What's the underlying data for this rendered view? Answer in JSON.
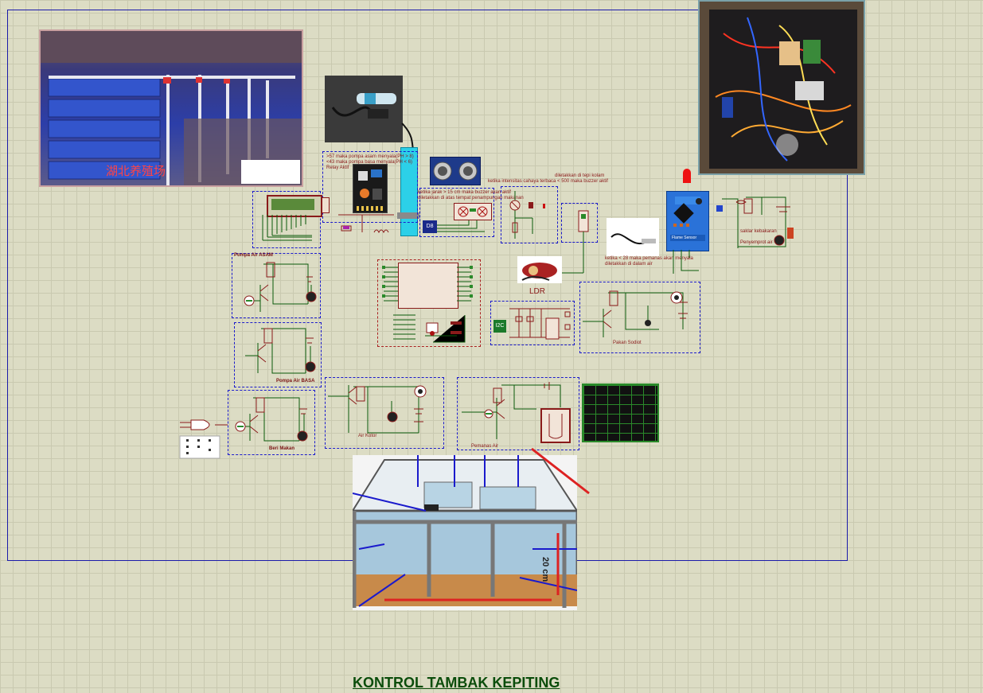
{
  "title": "KONTROL TAMBAK KEPITING",
  "labels": {
    "ph_note_1": ">57 maka pompa asam menyala(PH > 8)",
    "ph_note_2": "<43 maka pompa basa menyala(PH < 6)",
    "ph_note_3": "Relay Aktif",
    "ultrasonic_note_1": "ketika jarak > 15 cm maka buzzer akan aktif",
    "ultrasonic_note_2": "diletakkan di atas tempat penampungan makanan",
    "ldr_note_1": "diletakkan di tepi kolam",
    "ldr_note_2": "ketika intensitas cahaya terbaca < 500 maka buzzer aktif",
    "temp_note_1": "ketika < 28 maka pemanas akan menyala",
    "temp_note_2": "diletakkan di dalam air",
    "fire_note_1": "saklar kebakaran",
    "fire_note_2": "Penyemprot air",
    "pompa_asam": "Pompa Air ASAM",
    "pompa_basa": "Pompa Air BASA",
    "beri_makan": "Beri Makan",
    "air_kotor": "Air Kotor",
    "pemanas_air": "Pemanas Air",
    "pakan_sodiot": "Pakan Sodiot",
    "ldr": "LDR",
    "i2c": "I2C",
    "d8": "D8",
    "flame_sensor": "Flame Sensor",
    "photo_caption": "湖北养殖场",
    "dim_label": "20 cm"
  },
  "colors": {
    "wire": "#0a5a0a",
    "component": "#8a1a1a",
    "block_border": "#1a1acc",
    "grid_bg": "#dcdcc4",
    "title": "#0b4d0b"
  }
}
